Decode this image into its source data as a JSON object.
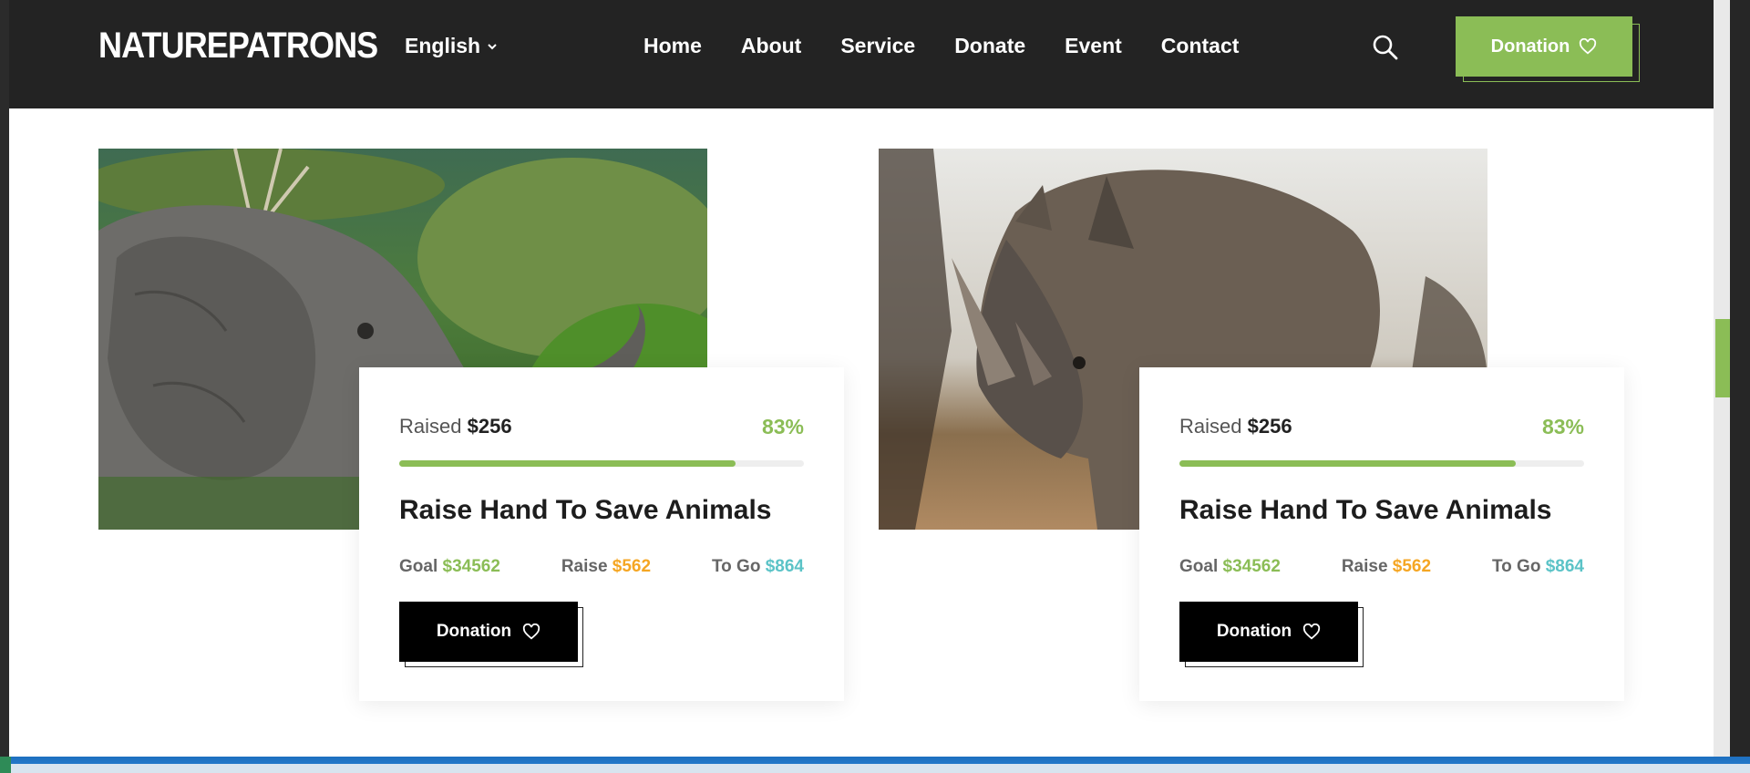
{
  "header": {
    "logo": "NATUREPATRONS",
    "language": "English",
    "nav": [
      "Home",
      "About",
      "Service",
      "Donate",
      "Event",
      "Contact"
    ],
    "donate_label": "Donation"
  },
  "causes": [
    {
      "image": "elephant",
      "raised_label": "Raised",
      "raised_value": "$256",
      "percent": "83%",
      "progress": 0.83,
      "title": "Raise Hand To Save Animals",
      "goal_label": "Goal",
      "goal_value": "$34562",
      "raise_label": "Raise",
      "raise_value": "$562",
      "togo_label": "To Go",
      "togo_value": "$864",
      "button_label": "Donation"
    },
    {
      "image": "rhino",
      "raised_label": "Raised",
      "raised_value": "$256",
      "percent": "83%",
      "progress": 0.83,
      "title": "Raise Hand To Save Animals",
      "goal_label": "Goal",
      "goal_value": "$34562",
      "raise_label": "Raise",
      "raise_value": "$562",
      "togo_label": "To Go",
      "togo_value": "$864",
      "button_label": "Donation"
    }
  ],
  "colors": {
    "accent": "#8bbd56",
    "header_bg": "#232323",
    "raise": "#f5a623",
    "togo": "#5bc3c7"
  },
  "icons": {
    "search": "search-icon",
    "heart": "heart-icon",
    "chevron": "chevron-down-icon"
  }
}
